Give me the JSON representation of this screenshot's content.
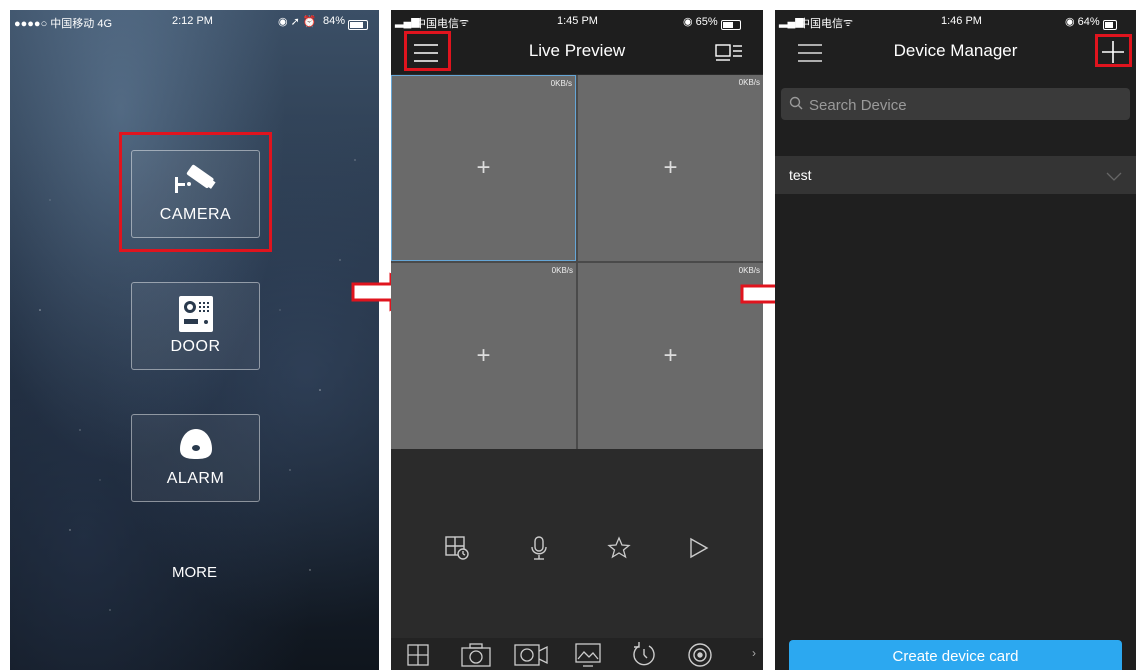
{
  "phone_home": {
    "status": {
      "carrier": "●●●●○ 中国移动 4G",
      "time": "2:12 PM",
      "battery": "84%"
    },
    "tiles": [
      {
        "label": "CAMERA",
        "icon": "cctv-camera-icon"
      },
      {
        "label": "DOOR",
        "icon": "door-intercom-icon"
      },
      {
        "label": "ALARM",
        "icon": "alarm-icon"
      }
    ],
    "more_label": "MORE"
  },
  "phone_live": {
    "status": {
      "carrier": "中国电信",
      "time": "1:45 PM",
      "battery": "65%"
    },
    "title": "Live Preview",
    "cells": [
      {
        "rate": "0KB/s",
        "selected": true
      },
      {
        "rate": "0KB/s",
        "selected": false
      },
      {
        "rate": "0KB/s",
        "selected": false
      },
      {
        "rate": "0KB/s",
        "selected": false
      }
    ],
    "controls": [
      "playback-grid-icon",
      "microphone-icon",
      "star-icon",
      "play-icon"
    ],
    "toolbar": [
      "split-screen-icon",
      "snapshot-icon",
      "record-icon",
      "image-quality-icon",
      "rotate-icon",
      "ptz-icon"
    ],
    "more_chevron": "›"
  },
  "phone_dev": {
    "status": {
      "carrier": "中国电信",
      "time": "1:46 PM",
      "battery": "64%"
    },
    "title": "Device Manager",
    "search_placeholder": "Search Device",
    "devices": [
      {
        "name": "test"
      }
    ],
    "create_label": "Create device card"
  },
  "colors": {
    "highlight": "#e0141e",
    "accent": "#2ca8f0",
    "selected_cell": "#66a6d6"
  }
}
